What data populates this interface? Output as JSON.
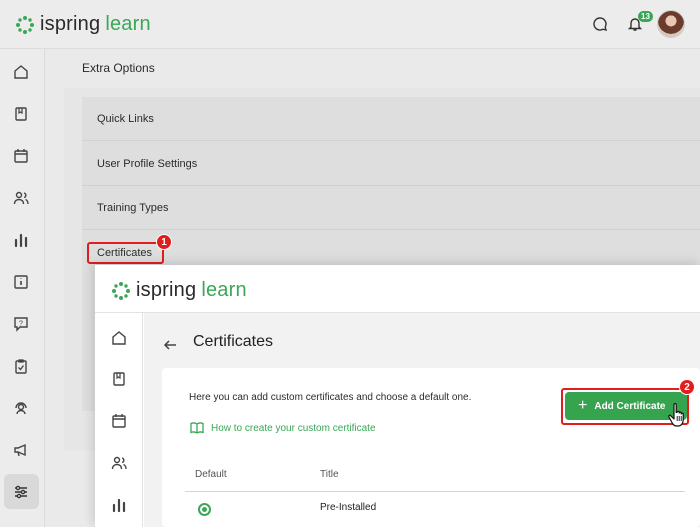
{
  "brand": {
    "word1": "ispring",
    "word2": "learn"
  },
  "header": {
    "notifications_count": "13"
  },
  "background": {
    "section_title": "Extra Options",
    "menu_items": [
      "Quick Links",
      "User Profile Settings",
      "Training Types",
      "Certificates"
    ]
  },
  "callouts": {
    "first": "1",
    "second": "2"
  },
  "foreground": {
    "page_title": "Certificates",
    "description": "Here you can add custom certificates and choose a default one.",
    "help_link": "How to create your custom certificate",
    "add_button": "Add Certificate",
    "table": {
      "columns": [
        "Default",
        "Title"
      ],
      "rows": [
        {
          "title": "Pre-Installed"
        }
      ]
    }
  },
  "colors": {
    "accent": "#3aa757",
    "callout": "#e01e1e"
  },
  "icons": {
    "header": [
      "chat-icon",
      "bell-icon"
    ],
    "sidebar": [
      "home-icon",
      "book-icon",
      "calendar-icon",
      "users-icon",
      "chart-icon",
      "info-icon",
      "question-icon",
      "clipboard-icon",
      "support-icon",
      "megaphone-icon",
      "settings-icon"
    ]
  }
}
